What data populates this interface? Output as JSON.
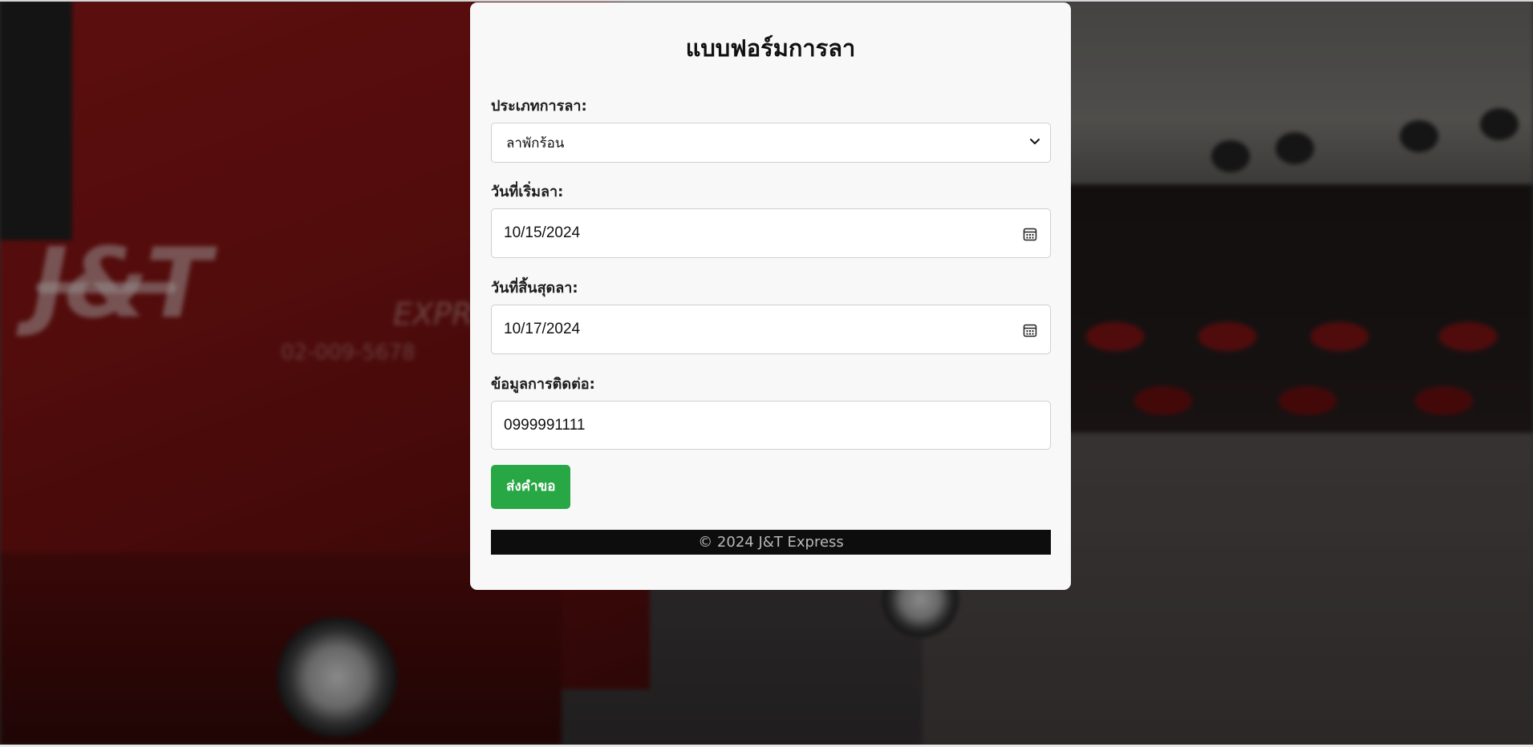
{
  "form": {
    "title": "แบบฟอร์มการลา",
    "leave_type": {
      "label": "ประเภทการลา:",
      "selected": "ลาพักร้อน"
    },
    "start_date": {
      "label": "วันที่เริ่มลา:",
      "value": "10/15/2024"
    },
    "end_date": {
      "label": "วันที่สิ้นสุดลา:",
      "value": "10/17/2024"
    },
    "contact": {
      "label": "ข้อมูลการติดต่อ:",
      "value": "0999991111"
    },
    "submit_label": "ส่งคำขอ"
  },
  "footer": {
    "text": "© 2024 J&T Express"
  },
  "background": {
    "logo_text": "J&T",
    "logo_sub": "EXPR",
    "phone_text": "02-009-5678"
  },
  "colors": {
    "submit": "#28a745",
    "card": "#f8f8f8",
    "footer_bg": "#0d0d0d"
  },
  "icons": {
    "select_arrow": "chevron-down-icon",
    "date_picker": "calendar-icon"
  }
}
